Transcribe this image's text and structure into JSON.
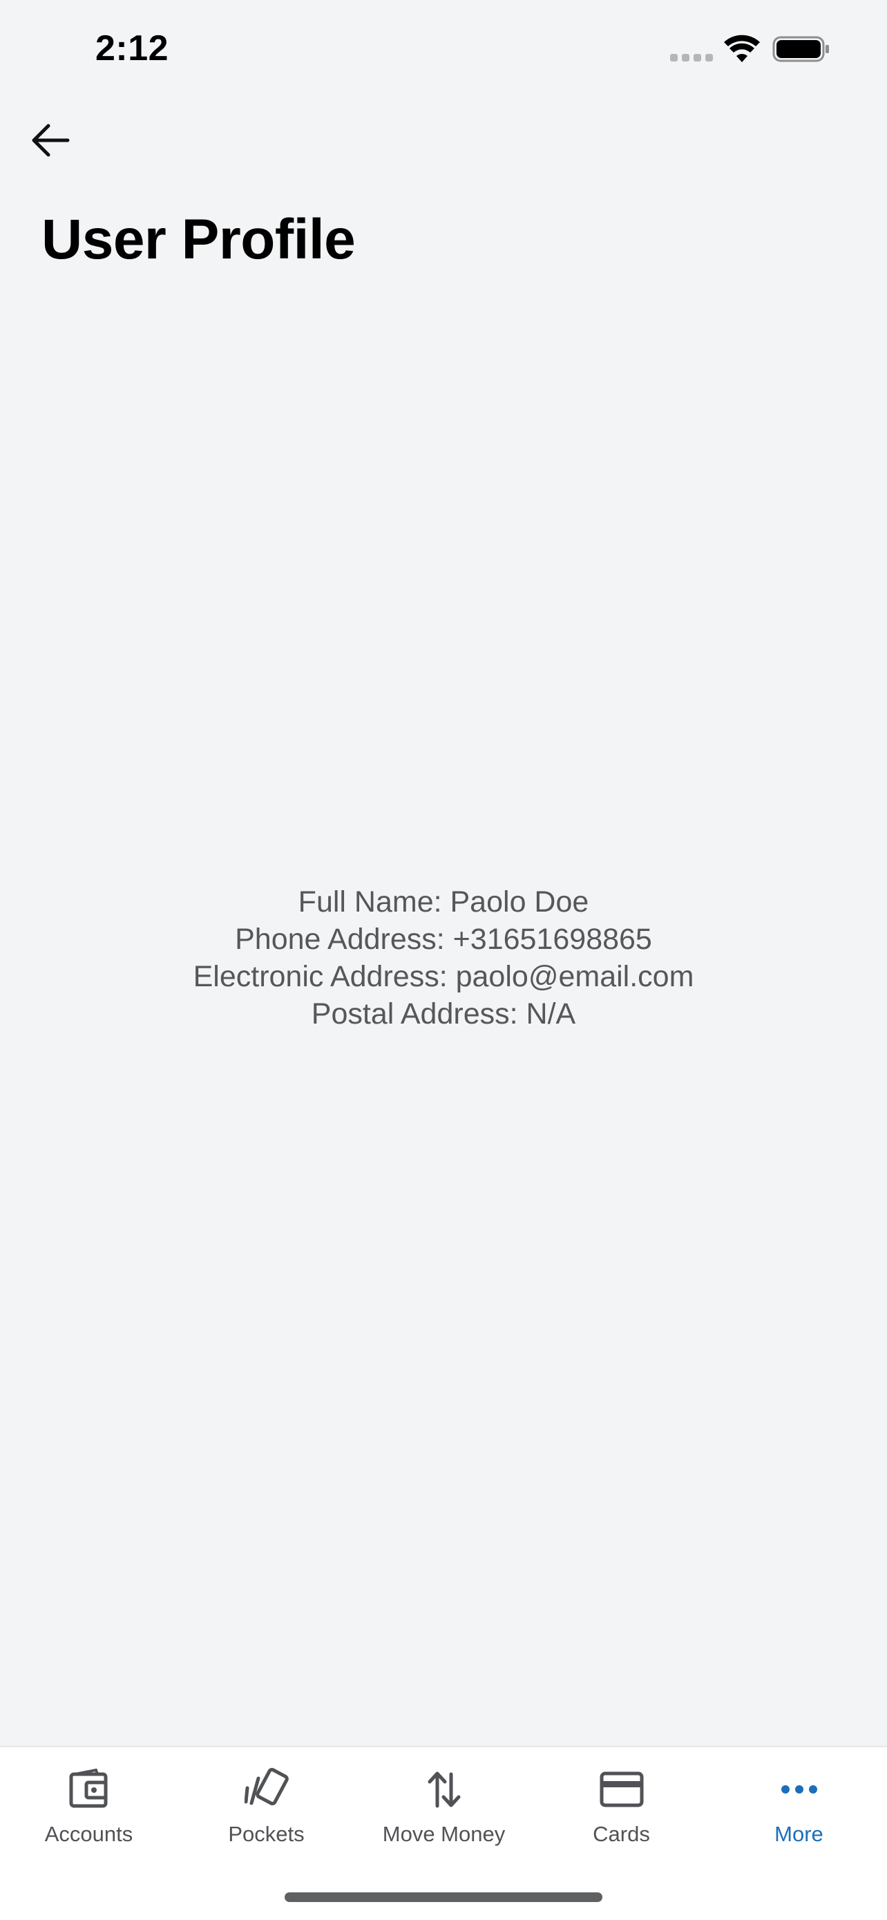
{
  "status_bar": {
    "time": "2:12"
  },
  "header": {
    "title": "User Profile",
    "back_icon": "arrow-left-icon"
  },
  "profile": {
    "full_name": "Full Name: Paolo Doe",
    "phone": "Phone Address: +31651698865",
    "email": "Electronic Address: paolo@email.com",
    "postal": "Postal Address: N/A"
  },
  "tab_bar": {
    "items": [
      {
        "label": "Accounts",
        "icon": "wallet-icon",
        "active": false
      },
      {
        "label": "Pockets",
        "icon": "cards-fan-icon",
        "active": false
      },
      {
        "label": "Move Money",
        "icon": "transfer-arrows-icon",
        "active": false
      },
      {
        "label": "Cards",
        "icon": "credit-card-icon",
        "active": false
      },
      {
        "label": "More",
        "icon": "more-dots-icon",
        "active": true
      }
    ]
  },
  "colors": {
    "background": "#f3f4f6",
    "accent": "#1a6fba",
    "tab_inactive": "#505255",
    "text_body": "#55575a"
  }
}
